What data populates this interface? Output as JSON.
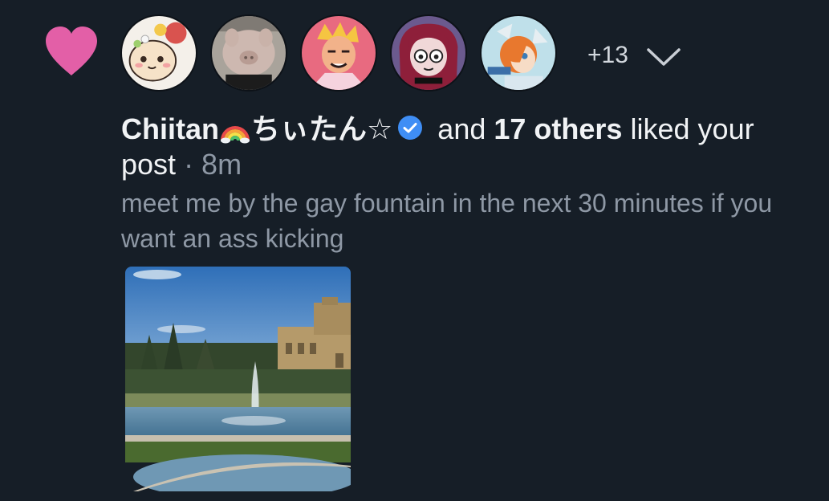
{
  "notification": {
    "icon": "heart-icon",
    "accent_color": "#e35fa7",
    "avatars": [
      {
        "name": "avatar-1"
      },
      {
        "name": "avatar-2"
      },
      {
        "name": "avatar-3"
      },
      {
        "name": "avatar-4"
      },
      {
        "name": "avatar-5"
      }
    ],
    "more_count": "+13",
    "expand_icon": "chevron-down-icon",
    "user_name": "Chiitan",
    "user_name_suffix": "ちぃたん☆",
    "verified_icon": "verified-badge-icon",
    "and_text": "and",
    "others_text": "17 others",
    "action_text": "liked",
    "action_text_2": "your post",
    "time_text": "· 8m",
    "post_text": "meet me by the gay fountain in the next 30 minutes if you want an ass kicking"
  }
}
